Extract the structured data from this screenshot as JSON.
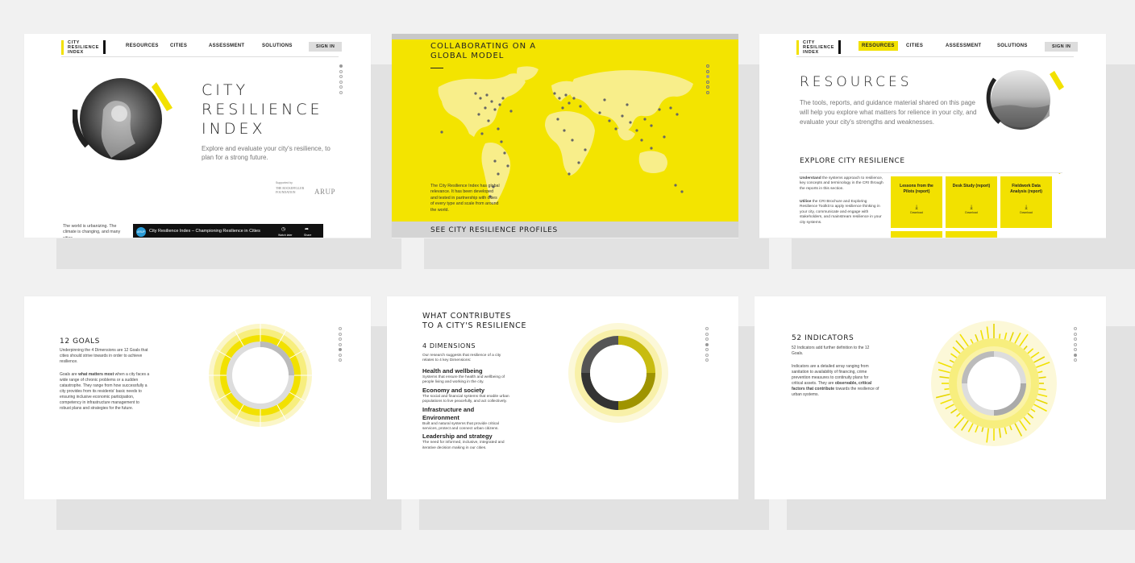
{
  "brand": {
    "logo_lines": [
      "CITY",
      "RESILIENCE",
      "INDEX"
    ],
    "accent": "#f2e100"
  },
  "nav": {
    "resources": "RESOURCES",
    "cities": "CITIES",
    "assessment": "ASSESSMENT",
    "solutions": "SOLUTIONS",
    "sign_in": "SIGN IN"
  },
  "home": {
    "title_lines": [
      "CITY",
      "RESILIENCE",
      "INDEX"
    ],
    "tagline": "Explore and evaluate your city's resilience, to plan for a strong future.",
    "supported_by": "Supported by",
    "partner_1": "THE ROCKEFELLER FOUNDATION",
    "partner_2": "ARUP",
    "intro_text": "The world is urbanizing. The climate is changing, and many cities",
    "video_badge": "ARUP",
    "video_title": "City Resilience Index – Championing Resilience in Cities",
    "video_watch_later": "Watch later",
    "video_share": "Share"
  },
  "map": {
    "title_lines": [
      "COLLABORATING ON A",
      "GLOBAL MODEL"
    ],
    "body": "The City Resilience Index has global relevance. It has been developed and tested in partnership with cities of every type and scale from around the world.",
    "footer": "SEE CITY RESILIENCE PROFILES"
  },
  "resources": {
    "title": "RESOURCES",
    "intro": "The tools, reports, and guidance material shared on this page will help you explore what matters for relience in your city, and evaluate your city's strengths and weaknesses.",
    "explore_heading": "EXPLORE CITY RESILIENCE",
    "understand_bold": "Understand",
    "understand_text": " the systems approach to resilience, key concepts and terminology in the CRI through the reports in this section.",
    "utilise_bold": "Utilise",
    "utilise_text": " the CRI Brochure and Exploring Resilience Toolkit to apply resilience thinking in your city, communicate and engage with stakeholders, and mainstream resilience in your city systems.",
    "cards": [
      {
        "title": "Lessons from the Pilots (report)",
        "action": "Download"
      },
      {
        "title": "Desk Study (report)",
        "action": "Download"
      },
      {
        "title": "Fieldwork Data Analysis (report)",
        "action": "Download"
      }
    ]
  },
  "goals": {
    "title": "12 GOALS",
    "p1": "Underpinning the 4 Dimensions are 12 Goals that cities should strive towards in order to achieve resilience.",
    "p2_pre": "Goals are ",
    "p2_bold": "what matters most",
    "p2_post": " when a city faces a wide range of chronic problems or a sudden catastrophe. They range from how successfully a city provides from its residents' basic needs to ensuring inclusive economic participation, competency in infrastructure management to robust plans and strategies for the future."
  },
  "dimensions": {
    "title_lines": [
      "WHAT CONTRIBUTES",
      "TO A CITY'S RESILIENCE"
    ],
    "heading": "4 DIMENSIONS",
    "intro": "Our research suggests that resilience of a city relates to 4 key Dimensions:",
    "items": [
      {
        "name": "Health and wellbeing",
        "desc": "Systems that ensure the health and wellbeing of people living and working in the city."
      },
      {
        "name": "Economy and society",
        "desc": "The social and financial systems that enable urban populations to live peacefully, and act collectively."
      },
      {
        "name": "Infrastructure and Environment",
        "desc": "Built and natural systems that provide critical services, protect and connect urban citizens."
      },
      {
        "name": "Leadership and strategy",
        "desc": "The need for informed, inclusive, integrated and iterative decision making in our cities."
      }
    ]
  },
  "indicators": {
    "title": "52 INDICATORS",
    "p1": "52 Indicators add further definition to the 12 Goals.",
    "p2_pre": "Indicators are a detailed array ranging from sanitation to availability of financing, crime prevention measures to continuity plans for critical assets. They are ",
    "p2_bold": "observable, critical factors that contribute",
    "p2_post": " towards the resilience of urban systems."
  }
}
